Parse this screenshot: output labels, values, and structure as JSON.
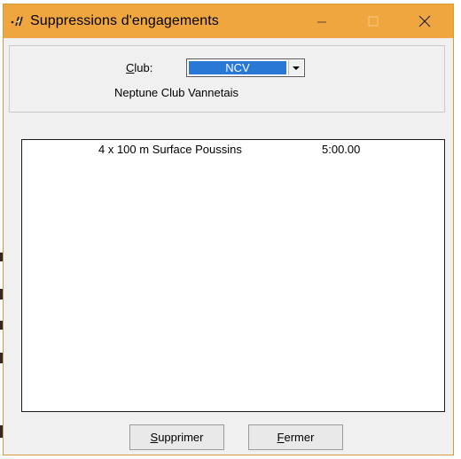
{
  "window": {
    "title": "Suppressions d'engagements",
    "accent_color": "#f0a63f"
  },
  "club": {
    "label_accel": "C",
    "label_rest": "lub:",
    "selected": "NCV",
    "name": "Neptune Club Vannetais"
  },
  "list": {
    "rows": [
      {
        "event": "4 x 100 m Surface Poussins",
        "time": "5:00.00"
      }
    ]
  },
  "buttons": {
    "delete_accel": "S",
    "delete_rest": "upprimer",
    "close_accel": "F",
    "close_rest": "ermer"
  },
  "icons": {
    "app": "app-icon",
    "minimize": "minimize-icon",
    "maximize": "maximize-icon",
    "close": "close-icon",
    "dropdown": "chevron-down-icon"
  }
}
